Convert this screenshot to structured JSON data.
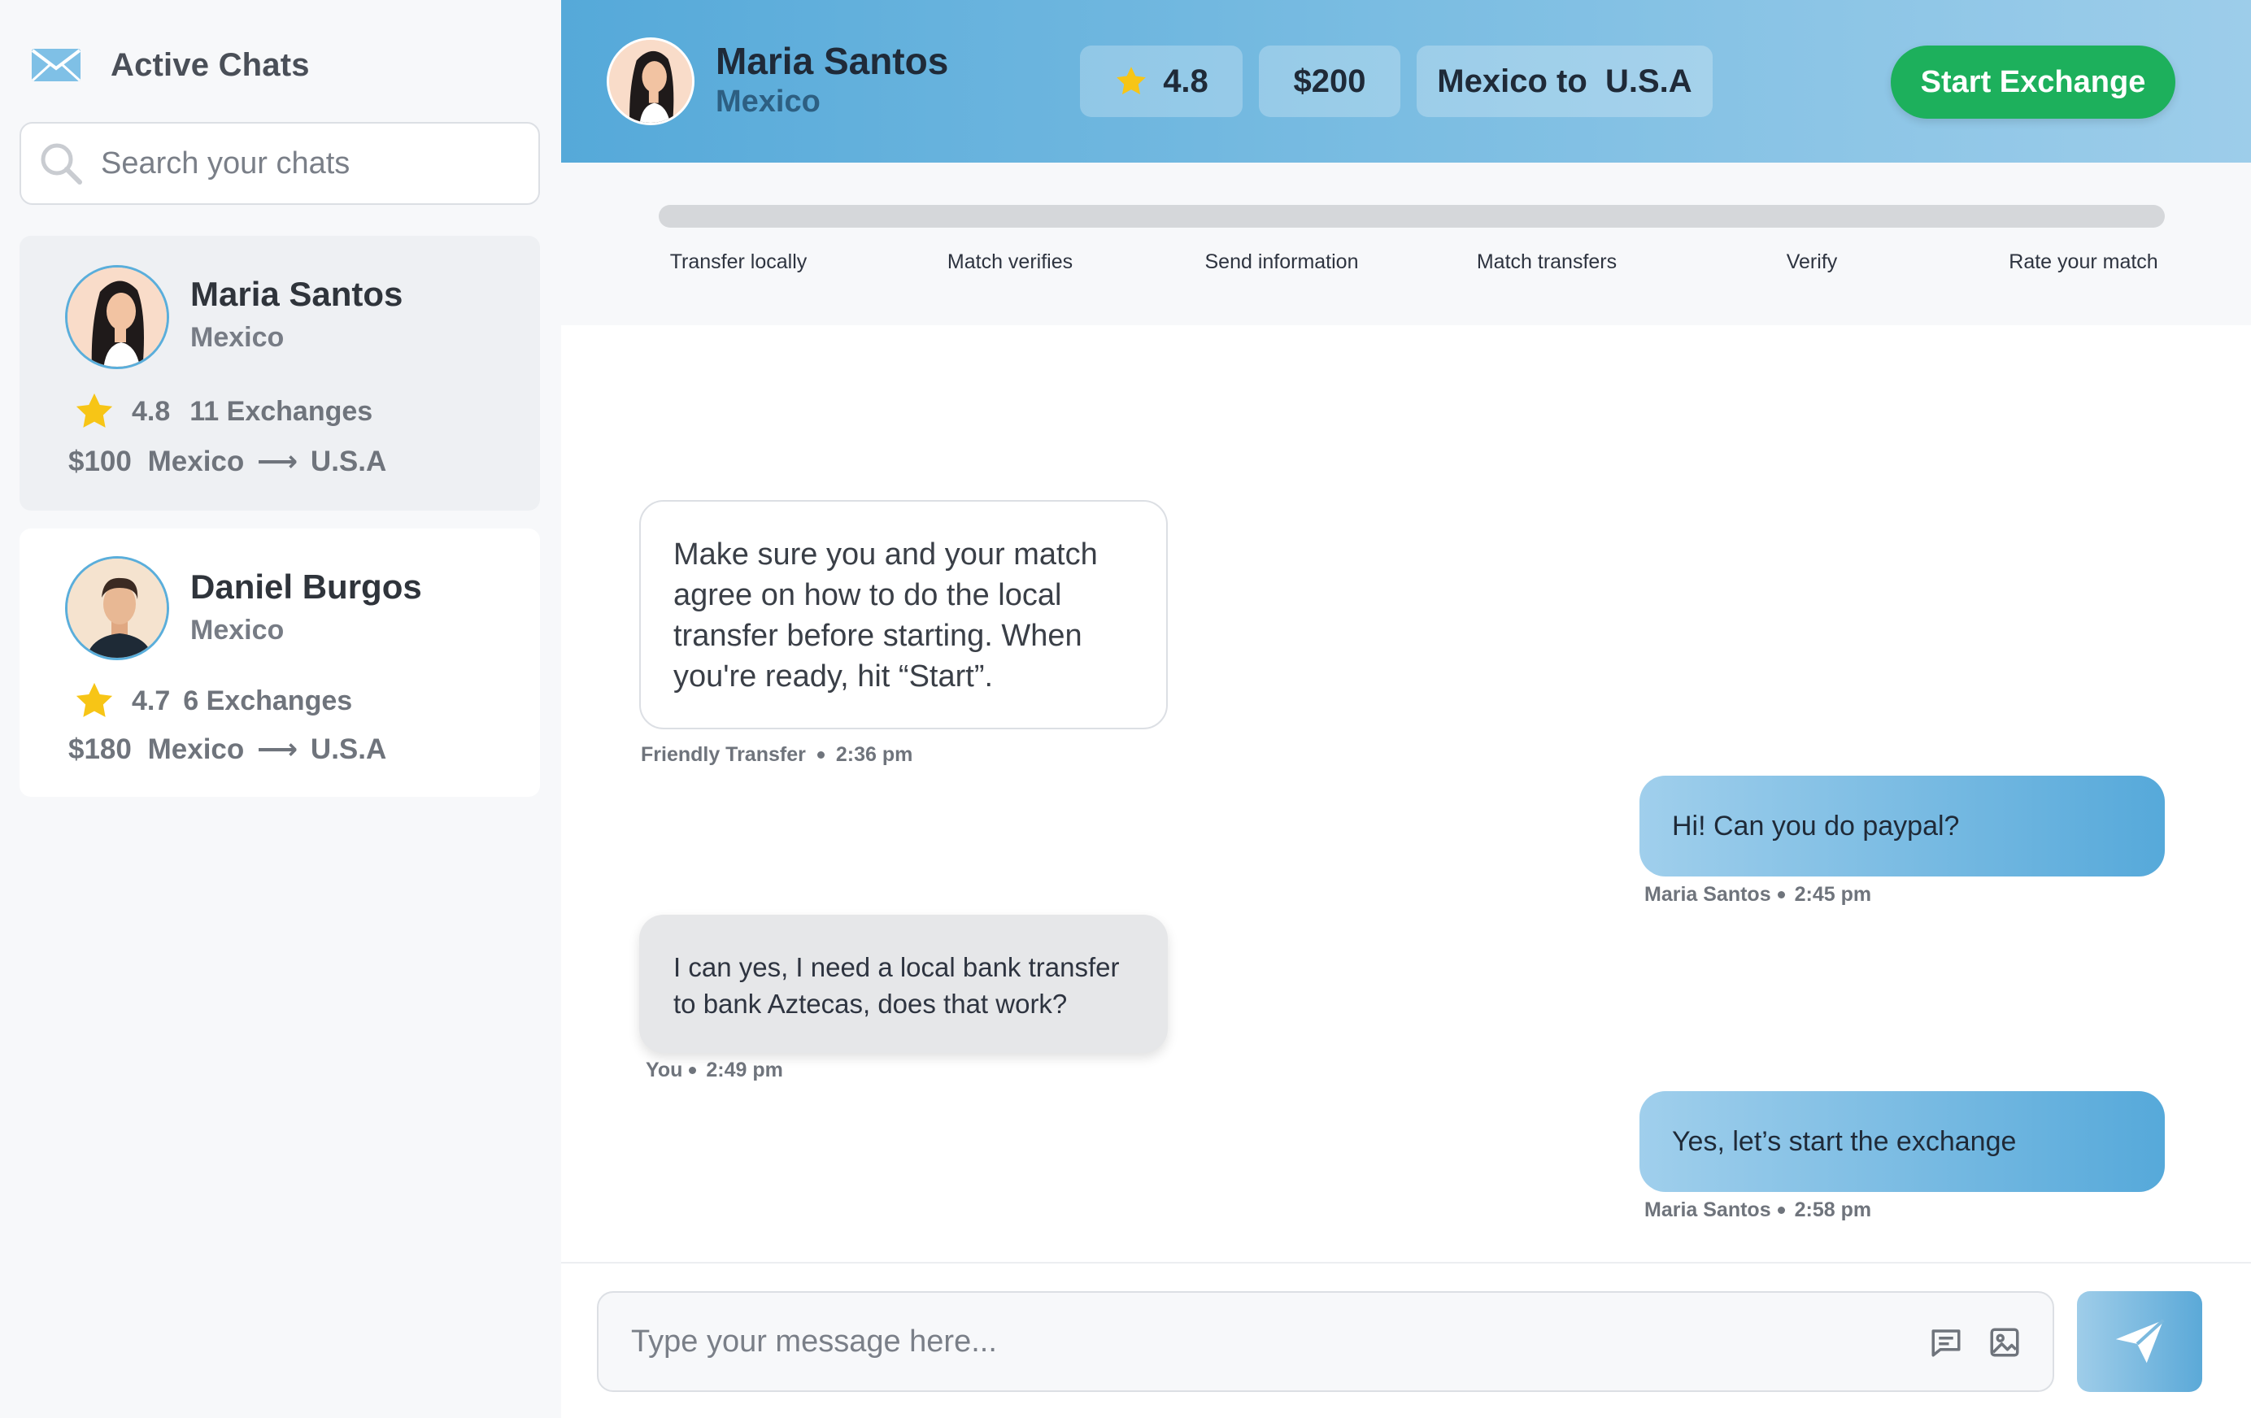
{
  "sidebar": {
    "title": "Active Chats",
    "search_placeholder": "Search your chats",
    "chats": [
      {
        "name": "Maria Santos",
        "country": "Mexico",
        "rating": "4.8",
        "exchanges": "11 Exchanges",
        "amount": "$100",
        "from": "Mexico",
        "arrow": "⟶",
        "to": "U.S.A",
        "active": true
      },
      {
        "name": "Daniel Burgos",
        "country": "Mexico",
        "rating": "4.7",
        "exchanges": "6 Exchanges",
        "amount": "$180",
        "from": "Mexico",
        "arrow": "⟶",
        "to": "U.S.A",
        "active": false
      }
    ]
  },
  "header": {
    "name": "Maria Santos",
    "country": "Mexico",
    "rating": "4.8",
    "amount": "$200",
    "route": "Mexico to  U.S.A",
    "start_button": "Start Exchange"
  },
  "progress": {
    "completed_fraction": 0,
    "steps": [
      "Transfer locally",
      "Match verifies",
      "Send information",
      "Match transfers",
      "Verify",
      "Rate your match"
    ]
  },
  "messages": [
    {
      "kind": "system",
      "text": "Make sure you and your match agree on how to do the local transfer before starting. When you're ready, hit “Start”.",
      "sender": "Friendly Transfer",
      "time": "2:36 pm"
    },
    {
      "kind": "mine",
      "text": "Hi! Can you do paypal?",
      "sender": "Maria Santos",
      "time": "2:45 pm"
    },
    {
      "kind": "theirs",
      "text": "I can yes, I need a local bank transfer to bank Aztecas, does that work?",
      "sender": "You",
      "time": "2:49 pm"
    },
    {
      "kind": "mine",
      "text": "Yes, let’s start the exchange",
      "sender": "Maria Santos",
      "time": "2:58 pm"
    }
  ],
  "composer": {
    "placeholder": "Type your message here..."
  },
  "icons": {
    "sidebar_header": "envelope-icon",
    "search": "search-icon",
    "rating": "star-icon",
    "composer_tools": [
      "chat-bubble-icon",
      "image-icon"
    ],
    "send": "paper-plane-icon"
  },
  "colors": {
    "accent": "#5aaedb",
    "start_button": "#1db05c",
    "star": "#f7c516"
  }
}
